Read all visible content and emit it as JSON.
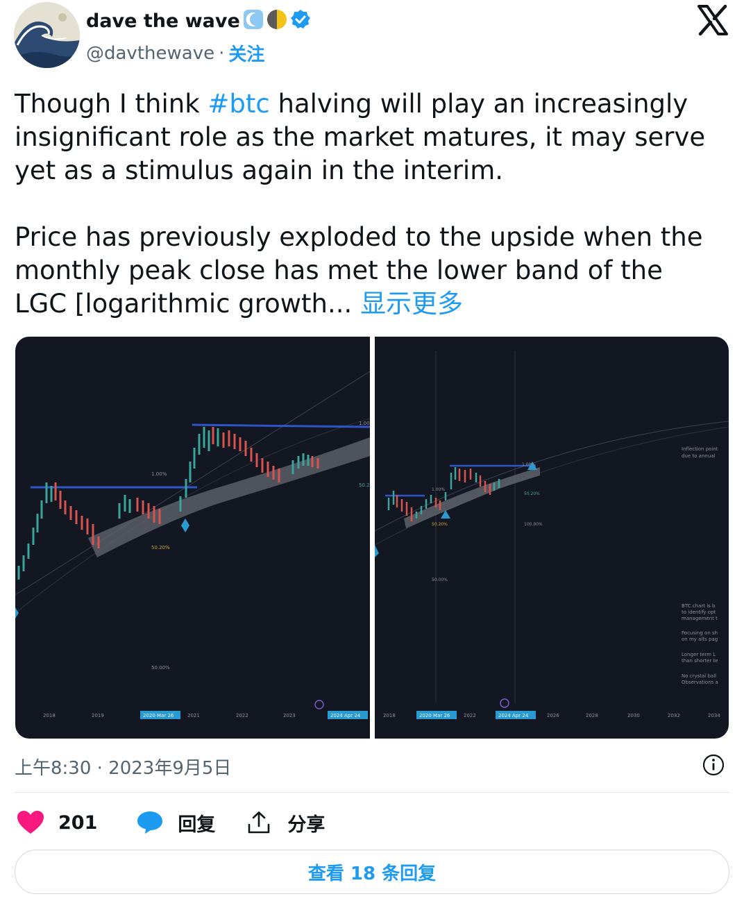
{
  "header": {
    "display_name": "dave the wave",
    "name_emojis": [
      "moon-icon",
      "half-moon-icon"
    ],
    "verified_icon": "verified-badge-icon",
    "handle": "@davthewave",
    "separator": "·",
    "follow_label": "关注",
    "platform_icon": "x-logo-icon"
  },
  "tweet": {
    "p1_before": "Though I think ",
    "hashtag": "#btc",
    "p1_after": " halving will play an increasingly insignificant role as the market matures, it may serve yet as a stimulus again in the interim.",
    "p2": "Price has previously exploded to the upside when the monthly peak close has met the lower band of the LGC [logarithmic growth... ",
    "show_more": "显示更多"
  },
  "media": {
    "left_chart": {
      "x_ticks": [
        "2018",
        "2019",
        "2020 Mar 26",
        "2021",
        "2022",
        "2023",
        "2024 Apr 24"
      ],
      "level_labels": [
        "1.00%",
        "50.20%",
        "50.00%"
      ]
    },
    "right_chart": {
      "x_ticks": [
        "2018",
        "2020 Mar 26",
        "2022",
        "2024 Apr 24",
        "2026",
        "2028",
        "2030",
        "2032",
        "2034"
      ],
      "side_note_top": [
        "Inflection point",
        "due to annual"
      ],
      "side_notes": [
        "BTC chart is b",
        "to identify opt",
        "management t",
        "Focusing on sh",
        "on my alts pag",
        "Longer term L",
        "than shorter te",
        "No crystal ball",
        "Observations a"
      ]
    }
  },
  "meta": {
    "timestamp": "上午8:30 · 2023年9月5日",
    "info_icon": "info-icon"
  },
  "actions": {
    "like_count": "201",
    "reply_label": "回复",
    "share_label": "分享"
  },
  "replies_button": "查看 18 条回复",
  "colors": {
    "accent": "#1d9bf0",
    "like": "#f91880",
    "chart_bg": "#131722",
    "level_line": "#2f56c7"
  }
}
